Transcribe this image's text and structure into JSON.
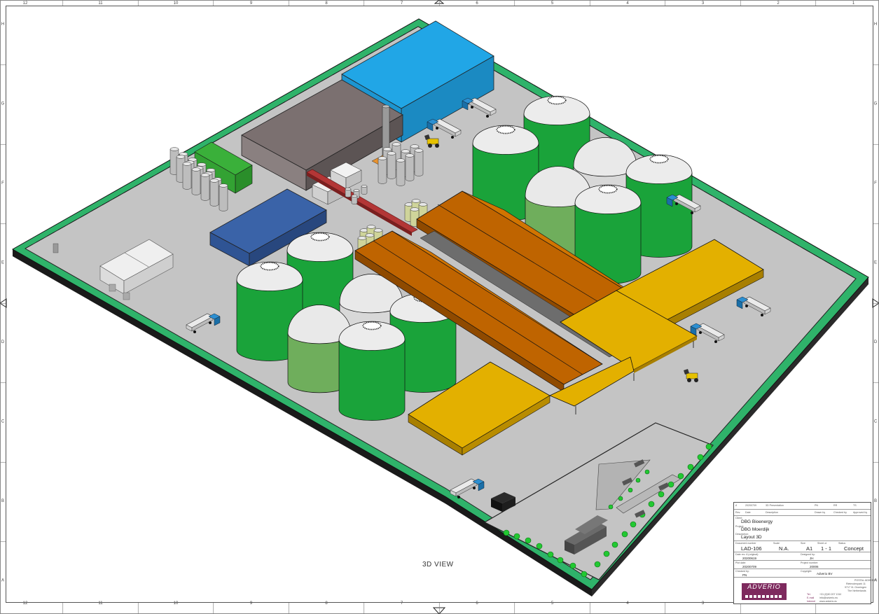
{
  "drawing": {
    "view_label": "3D VIEW",
    "frame_columns": [
      "12",
      "11",
      "10",
      "9",
      "8",
      "7",
      "6",
      "5",
      "4",
      "3",
      "2",
      "1"
    ],
    "frame_rows": [
      "H",
      "G",
      "F",
      "E",
      "D",
      "C",
      "B",
      "A"
    ],
    "colors": {
      "ground": "#c4c4c4",
      "border_green": "#2fb36a",
      "digester_green": "#1aa33a",
      "dome_white": "#e8e8e8",
      "roof_orange": "#c86a00",
      "roof_yellow": "#e0ad00",
      "hall_blue": "#2b9ed9",
      "hall_navy": "#3a63a8",
      "hall_brown": "#7a6e6e"
    }
  },
  "title_block": {
    "revision_row": {
      "rev": "A",
      "date": "20200709",
      "description": "3D Presentation",
      "pn": "PN",
      "rr": "RR",
      "ts": "TS"
    },
    "header_row": {
      "rev": "Rev.",
      "date": "Date",
      "description": "Description",
      "drawn": "Drawn by",
      "checked": "Checked by",
      "approved": "Approved by",
      "status": "Status"
    },
    "client_label": "Client:",
    "client": "DBG Bioenergy",
    "project_label": "Project:",
    "project": "DBG Moerdijk",
    "description_label": "Description:",
    "description": "Layout 3D",
    "document_number_label": "Document number",
    "document_number": "LAD-106",
    "scale_label": "Scale",
    "scale": "N.A.",
    "size_label": "Size",
    "size": "A1",
    "sheet_label": "Sheet of",
    "sheet": "1 - 1",
    "status_label": "Status",
    "status": "Concept",
    "date_rev_label": "Date rev. A (original):",
    "date_rev": "20200619",
    "designed_by_label": "Designed by:",
    "designed_by": "JH",
    "plot_date_label": "Plot date:",
    "plot_date": "20200709",
    "project_number_label": "Project number:",
    "project_number": "20006",
    "checked_by_label": "Checked by:",
    "checked_by": "PN",
    "copyright_label": "Copyright:",
    "copyright": "Adverio BV",
    "logo_text": "ADVERIO",
    "address_lines": [
      "POSTAL ADDRESS",
      "Rietmolenpark 11",
      "9717 VL Groningen",
      "The Netherlands"
    ],
    "contact_labels": [
      "Tel.",
      "E-mail",
      "Internet"
    ],
    "contact_values": [
      "+31 (0)50 207 1316",
      "info@adverio.eu",
      "www.adverio.eu"
    ]
  }
}
